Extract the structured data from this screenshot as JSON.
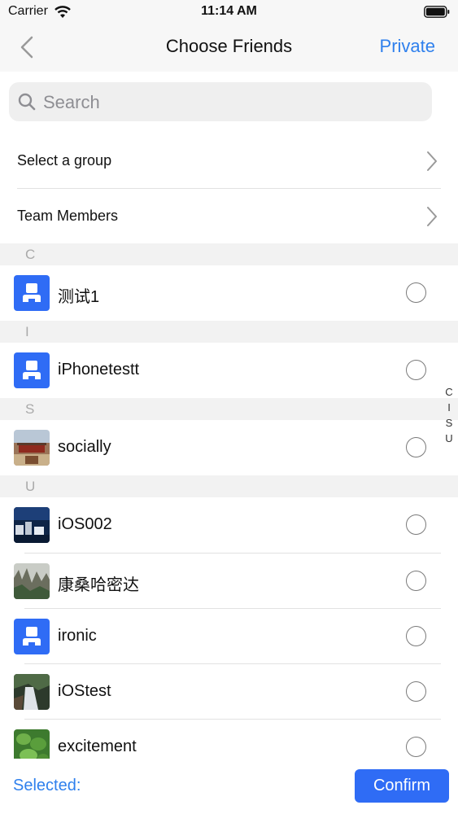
{
  "status_bar": {
    "carrier": "Carrier",
    "time": "11:14 AM"
  },
  "nav": {
    "title": "Choose Friends",
    "private_label": "Private",
    "accent": "#2f80ed"
  },
  "search": {
    "placeholder": "Search"
  },
  "links": {
    "select_group": "Select a group",
    "team_members": "Team Members"
  },
  "sections": [
    "C",
    "I",
    "S",
    "U"
  ],
  "contacts": [
    {
      "name": "测试1",
      "avatar": "default-user-icon"
    },
    {
      "name": "iPhonetestt",
      "avatar": "default-user-icon"
    },
    {
      "name": "socially",
      "avatar": "palace-photo"
    },
    {
      "name": "iOS002",
      "avatar": "night-city-photo"
    },
    {
      "name": "康桑哈密达",
      "avatar": "mountain-photo"
    },
    {
      "name": "ironic",
      "avatar": "default-user-icon"
    },
    {
      "name": "iOStest",
      "avatar": "waterfall-photo"
    },
    {
      "name": "excitement",
      "avatar": "green-leaves-photo"
    }
  ],
  "index_letters": [
    "C",
    "I",
    "S",
    "U"
  ],
  "footer": {
    "selected_label": "Selected:",
    "confirm_label": "Confirm",
    "button_color": "#2f6cf5"
  }
}
